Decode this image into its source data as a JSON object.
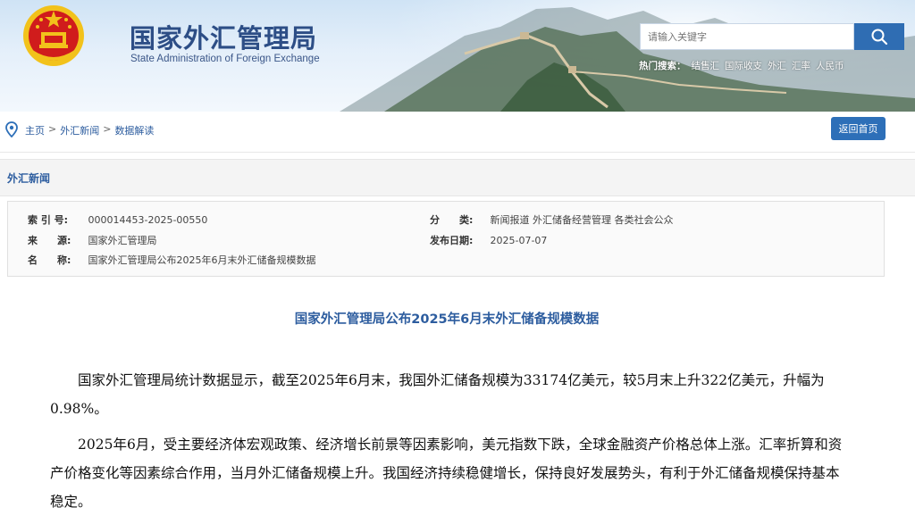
{
  "header": {
    "title": "国家外汇管理局",
    "subtitle": "State Administration of Foreign Exchange",
    "search_placeholder": "请输入关键字",
    "hot_search": {
      "label": "热门搜索：",
      "items": [
        "结售汇",
        "国际收支",
        "外汇",
        "汇率",
        "人民币"
      ]
    }
  },
  "breadcrumb": {
    "items": [
      "主页",
      "外汇新闻",
      "数据解读"
    ],
    "separator": ">",
    "home_button": "返回首页"
  },
  "section": {
    "title": "外汇新闻"
  },
  "meta": {
    "index_label": "索 引 号:",
    "index_value": "000014453-2025-00550",
    "category_label": "分　　类:",
    "category_value": "新闻报道  外汇储备经营管理  各类社会公众",
    "source_label": "来　　源:",
    "source_value": "国家外汇管理局",
    "date_label": "发布日期:",
    "date_value": "2025-07-07",
    "name_label": "名　　称:",
    "name_value": "国家外汇管理局公布2025年6月末外汇储备规模数据"
  },
  "article": {
    "title": "国家外汇管理局公布2025年6月末外汇储备规模数据",
    "paragraphs": [
      "国家外汇管理局统计数据显示，截至2025年6月末，我国外汇储备规模为33174亿美元，较5月末上升322亿美元，升幅为0.98%。",
      "2025年6月，受主要经济体宏观政策、经济增长前景等因素影响，美元指数下跌，全球金融资产价格总体上涨。汇率折算和资产价格变化等因素综合作用，当月外汇储备规模上升。我国经济持续稳健增长，保持良好发展势头，有利于外汇储备规模保持基本稳定。"
    ]
  },
  "colors": {
    "brand_blue": "#2d5d9f",
    "button_blue": "#2d6fb8",
    "emblem_red": "#d01c1c",
    "emblem_gold": "#f2c21b"
  }
}
